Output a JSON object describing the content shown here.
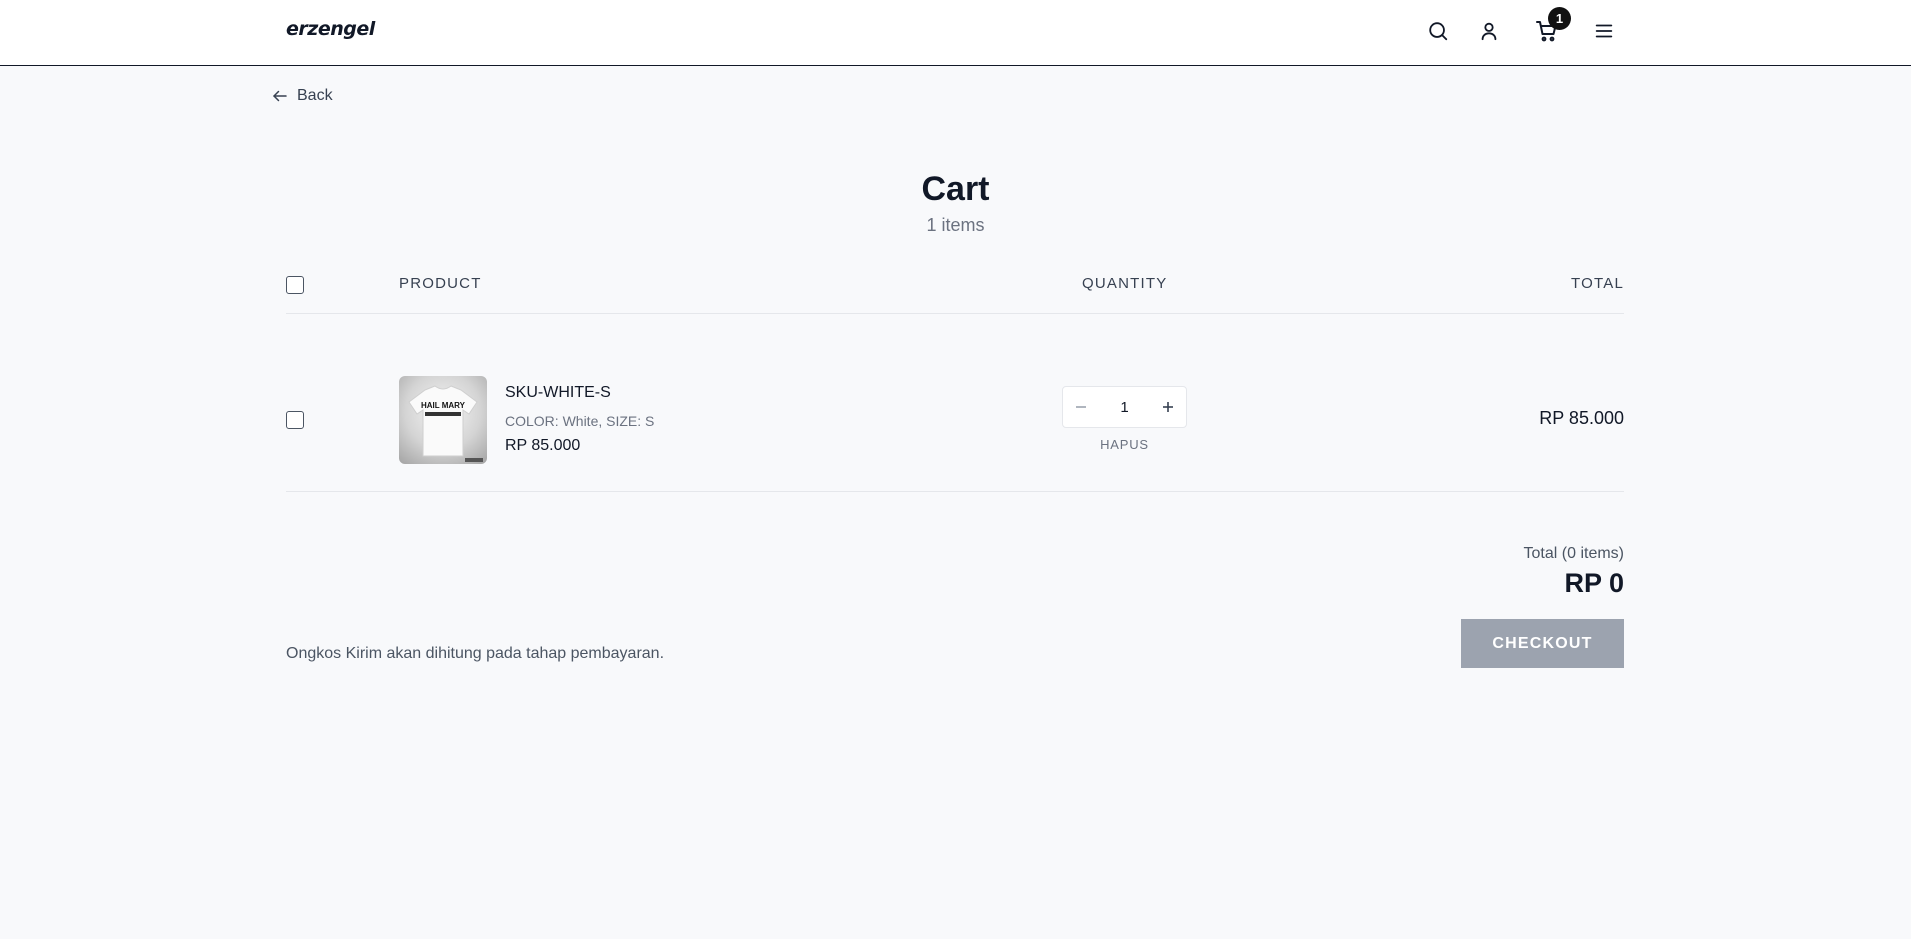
{
  "header": {
    "logo": "erzengel",
    "cart_count": "1",
    "icons": [
      "search-icon",
      "user-icon",
      "cart-icon",
      "menu-icon"
    ]
  },
  "nav": {
    "back_label": "Back"
  },
  "page": {
    "title": "Cart",
    "item_count_text": "1 items"
  },
  "table": {
    "headers": {
      "product": "PRODUCT",
      "quantity": "QUANTITY",
      "total": "TOTAL"
    },
    "rows": [
      {
        "name": "SKU-WHITE-S",
        "variant": "COLOR: White, SIZE: S",
        "price": "RP 85.000",
        "quantity": "1",
        "remove_label": "HAPUS",
        "total": "RP 85.000",
        "thumbnail_text": "HAIL MARY",
        "selected": false
      }
    ]
  },
  "summary": {
    "total_label": "Total (0 items)",
    "total_value": "RP 0",
    "checkout_label": "CHECKOUT",
    "shipping_note": "Ongkos Kirim akan dihitung pada tahap pembayaran."
  },
  "colors": {
    "header_border": "#111827",
    "checkout_bg": "#9ca3af",
    "badge_bg": "#111111",
    "page_bg": "#f8f9fb"
  }
}
